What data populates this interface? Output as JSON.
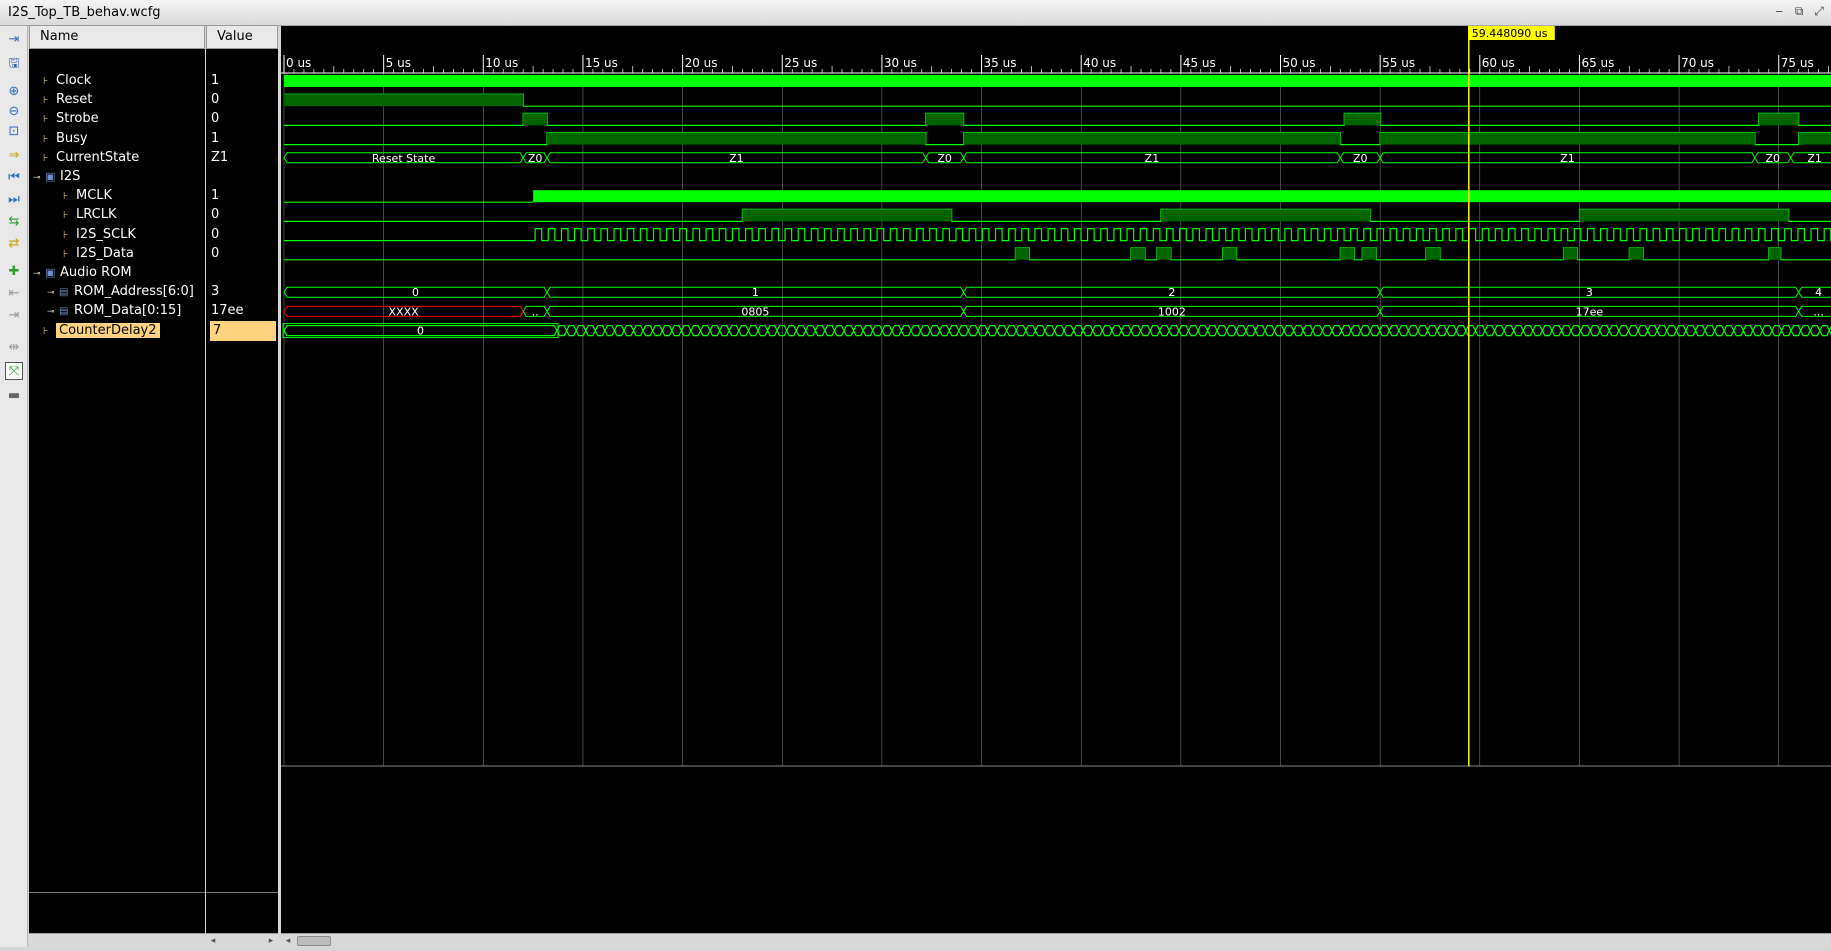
{
  "window": {
    "title": "I2S_Top_TB_behav.wcfg"
  },
  "columns": {
    "name": "Name",
    "value": "Value"
  },
  "cursor": {
    "label": "59.448090 us",
    "time_us": 59.44809
  },
  "timeline": {
    "ticks": [
      "0 us",
      "5 us",
      "10 us",
      "15 us",
      "20 us",
      "25 us",
      "30 us",
      "35 us",
      "40 us",
      "45 us",
      "50 us",
      "55 us",
      "60 us",
      "65 us",
      "70 us",
      "75 us"
    ]
  },
  "signals": [
    {
      "name": "Clock",
      "value": "1",
      "kind": "signal",
      "indent": 0
    },
    {
      "name": "Reset",
      "value": "0",
      "kind": "signal",
      "indent": 0
    },
    {
      "name": "Strobe",
      "value": "0",
      "kind": "signal",
      "indent": 0
    },
    {
      "name": "Busy",
      "value": "1",
      "kind": "signal",
      "indent": 0
    },
    {
      "name": "CurrentState",
      "value": "Z1",
      "kind": "signal",
      "indent": 0
    },
    {
      "name": "I2S",
      "value": "",
      "kind": "group",
      "indent": 0
    },
    {
      "name": "MCLK",
      "value": "1",
      "kind": "signal",
      "indent": 1
    },
    {
      "name": "LRCLK",
      "value": "0",
      "kind": "signal",
      "indent": 1
    },
    {
      "name": "I2S_SCLK",
      "value": "0",
      "kind": "signal",
      "indent": 1
    },
    {
      "name": "I2S_Data",
      "value": "0",
      "kind": "signal",
      "indent": 1
    },
    {
      "name": "Audio ROM",
      "value": "",
      "kind": "group",
      "indent": 0
    },
    {
      "name": "ROM_Address[6:0]",
      "value": "3",
      "kind": "bus",
      "indent": 1
    },
    {
      "name": "ROM_Data[0:15]",
      "value": "17ee",
      "kind": "bus",
      "indent": 1
    },
    {
      "name": "CounterDelay2",
      "value": "7",
      "kind": "signal",
      "indent": 0,
      "selected": true
    }
  ],
  "bus_labels": {
    "current_state": [
      "Reset State",
      "Z0",
      "Z1",
      "Z0",
      "Z1",
      "Z0",
      "Z1",
      "Z0",
      "Z1"
    ],
    "rom_address": [
      "0",
      "1",
      "2",
      "3",
      "4"
    ],
    "rom_data": [
      "XXXX",
      "..",
      "0805",
      "1002",
      "17ee",
      "..."
    ],
    "counter_delay": [
      "0"
    ]
  },
  "colors": {
    "wave": "#00ff00",
    "wave_dim": "#006400",
    "cursor": "#ffff00",
    "undefined": "#ff0000",
    "selected": "#ffd27f"
  }
}
